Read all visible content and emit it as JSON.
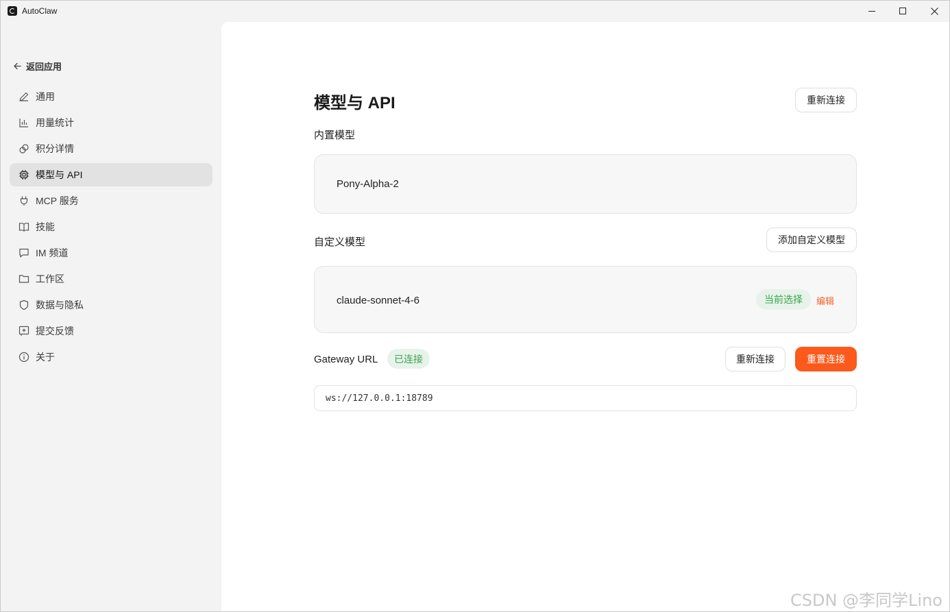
{
  "window": {
    "title": "AutoClaw"
  },
  "sidebar": {
    "back_label": "返回应用",
    "items": [
      {
        "label": "通用",
        "icon": "pencil-icon"
      },
      {
        "label": "用量统计",
        "icon": "bar-chart-icon"
      },
      {
        "label": "积分详情",
        "icon": "coins-icon"
      },
      {
        "label": "模型与 API",
        "icon": "chip-icon",
        "active": true
      },
      {
        "label": "MCP 服务",
        "icon": "plug-icon"
      },
      {
        "label": "技能",
        "icon": "book-icon"
      },
      {
        "label": "IM 频道",
        "icon": "message-icon"
      },
      {
        "label": "工作区",
        "icon": "folder-icon"
      },
      {
        "label": "数据与隐私",
        "icon": "shield-icon"
      },
      {
        "label": "提交反馈",
        "icon": "feedback-icon"
      },
      {
        "label": "关于",
        "icon": "info-icon"
      }
    ]
  },
  "main": {
    "title": "模型与 API",
    "reconnect_top_label": "重新连接",
    "builtin": {
      "label": "内置模型",
      "model": "Pony-Alpha-2"
    },
    "custom": {
      "label": "自定义模型",
      "add_label": "添加自定义模型",
      "model": "claude-sonnet-4-6",
      "selected_badge": "当前选择",
      "edit_label": "编辑"
    },
    "gateway": {
      "label": "Gateway URL",
      "status": "已连接",
      "reconnect_label": "重新连接",
      "reset_label": "重置连接",
      "url": "ws://127.0.0.1:18789"
    }
  },
  "watermark": "CSDN @李同学Lino",
  "colors": {
    "accent": "#fb5a1c",
    "success": "#3aa44f",
    "success_bg": "#e7f3ea"
  }
}
